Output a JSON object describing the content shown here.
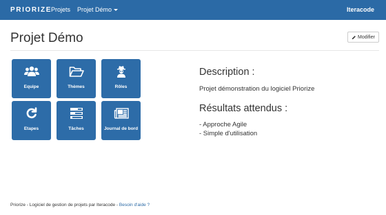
{
  "navbar": {
    "brand": "PRIORIZE",
    "links": [
      {
        "label": "Projets"
      },
      {
        "label": "Projet Démo"
      }
    ],
    "user": "Iteracode"
  },
  "header": {
    "title": "Projet Démo",
    "edit_label": "Modifier"
  },
  "tiles": [
    {
      "label": "Equipe",
      "icon": "users-icon"
    },
    {
      "label": "Thèmes",
      "icon": "folder-open-icon"
    },
    {
      "label": "Rôles",
      "icon": "user-secret-icon"
    },
    {
      "label": "Etapes",
      "icon": "refresh-icon"
    },
    {
      "label": "Tâches",
      "icon": "tasks-icon"
    },
    {
      "label": "Journal de bord",
      "icon": "newspaper-icon"
    }
  ],
  "description": {
    "title": "Description :",
    "text": "Projet démonstration du logiciel Priorize"
  },
  "results": {
    "title": "Résultats attendus :",
    "items": [
      "- Approche Agile",
      "- Simple d'utilisation"
    ]
  },
  "footer": {
    "text": "Priorize - Logiciel de gestion de projets par Iteracode - ",
    "help_link": "Besoin d'aide ?"
  },
  "colors": {
    "navbar": "#2b6aa6",
    "tile": "#2d6ca8",
    "link": "#2b6aa6"
  }
}
